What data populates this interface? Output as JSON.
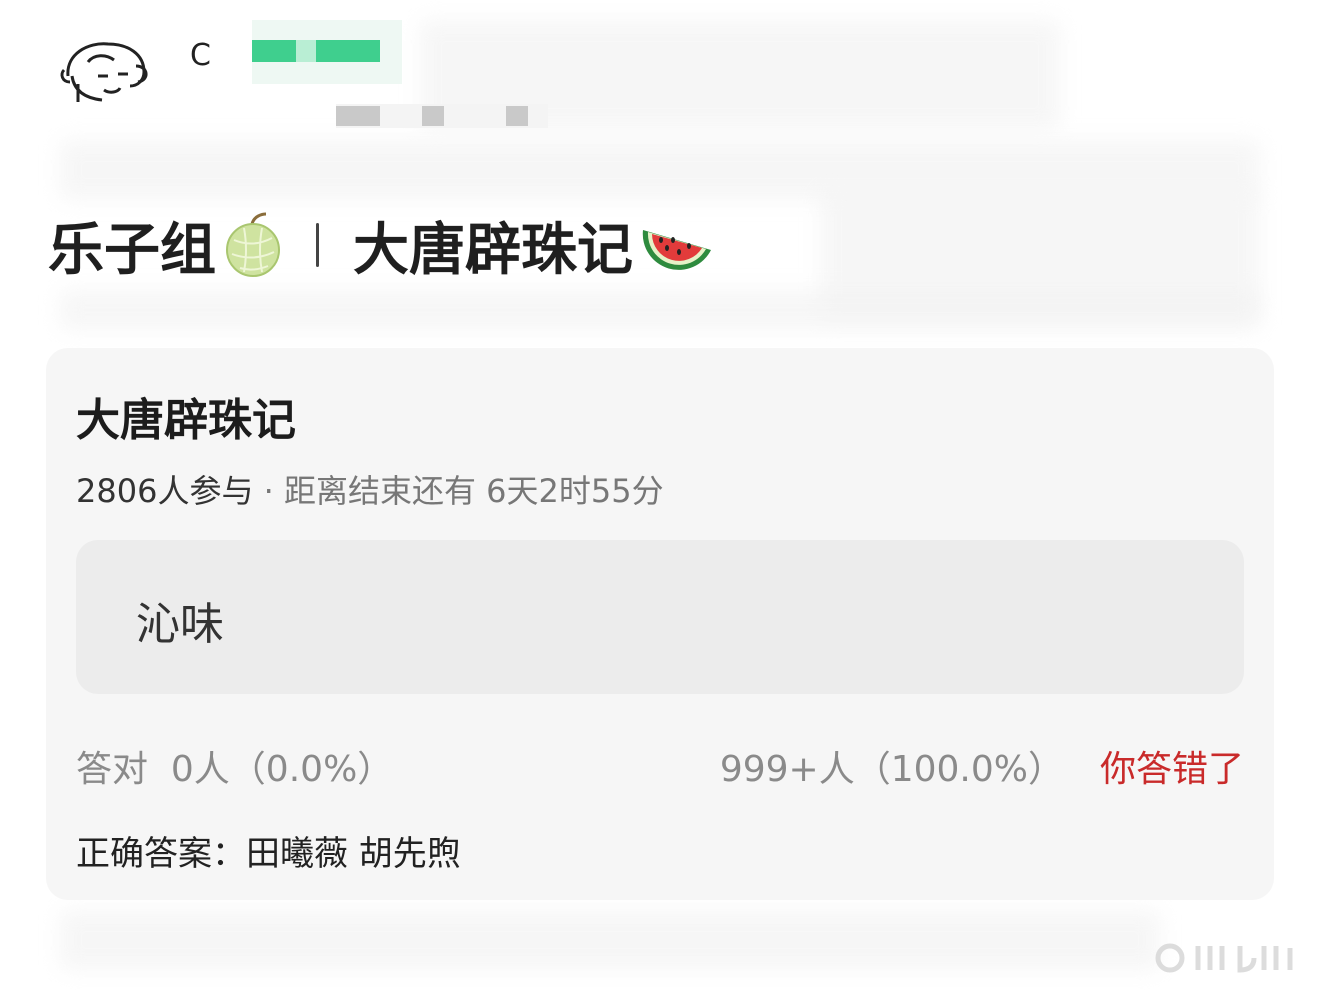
{
  "header": {
    "username_initial": "C"
  },
  "headline": {
    "left_text": "乐子组",
    "left_icon": "melon-emoji",
    "right_text": "大唐辟珠记",
    "right_icon": "watermelon-emoji"
  },
  "quiz": {
    "title": "大唐辟珠记",
    "participants": "2806人参与",
    "separator": " · ",
    "deadline": "距离结束还有 6天2时55分",
    "option": "沁味",
    "correct_label": "答对",
    "correct_count": "0人（0.0%）",
    "other_count": "999+人（100.0%）",
    "result": "你答错了",
    "answer_label": "正确答案：",
    "answer_value": "田曦薇 胡先煦"
  },
  "colors": {
    "wrong": "#c92a2a",
    "card": "#f6f6f6",
    "option_bg": "#ececec",
    "mosaic_green": "#3fcf8e"
  }
}
